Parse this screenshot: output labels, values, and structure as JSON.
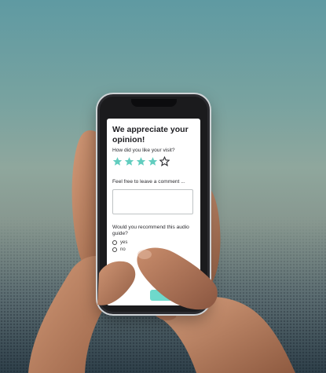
{
  "survey": {
    "headline": "We appreciate your opinion!",
    "rating_question": "How did you like your visit?",
    "rating": {
      "value": 4,
      "max": 5
    },
    "comment_label": "Feel free to leave a comment ...",
    "comment_value": "",
    "recommend_question": "Would you recommend this audio guide?",
    "options": [
      {
        "label": "yes",
        "selected": false
      },
      {
        "label": "no",
        "selected": false
      }
    ]
  },
  "colors": {
    "accent": "#6ed9cb",
    "star_filled": "#62cdbf",
    "star_empty_stroke": "#2a2a2e",
    "phone_body": "#1b1b1d",
    "skin": "#c08a6a"
  }
}
